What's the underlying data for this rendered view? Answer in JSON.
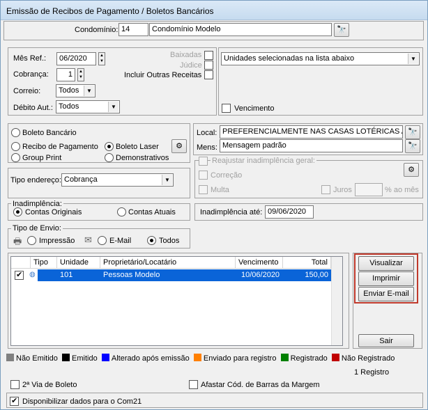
{
  "window": {
    "title": "Emissão de Recibos de Pagamento / Boletos Bancários"
  },
  "condominio": {
    "label": "Condomínio:",
    "code": "14",
    "name": "Condomínio Modelo"
  },
  "params": {
    "mes_ref_label": "Mês Ref.:",
    "mes_ref": "06/2020",
    "cobranca_label": "Cobrança:",
    "cobranca": "1",
    "correio_label": "Correio:",
    "correio": "Todos",
    "debito_label": "Débito Aut.:",
    "debito": "Todos",
    "baixadas": "Baixadas",
    "judice": "Júdice",
    "incluir": "Incluir Outras Receitas"
  },
  "unidades": {
    "selection": "Unidades selecionadas na lista abaixo",
    "vencimento": "Vencimento"
  },
  "tipo": {
    "boleto_bancario": "Boleto Bancário",
    "recibo": "Recibo de Pagamento",
    "group_print": "Group Print",
    "boleto_laser": "Boleto Laser",
    "demonstrativos": "Demonstrativos"
  },
  "local": {
    "label": "Local:",
    "value": "PREFERENCIALMENTE NAS CASAS LOTÉRICAS ATÉ O",
    "mens_label": "Mens:",
    "mens_value": "Mensagem padrão"
  },
  "reajustar": {
    "title": "Reajustar inadimplência geral:",
    "correcao": "Correção",
    "multa": "Multa",
    "juros": "Juros",
    "juros_unit": "% ao mês"
  },
  "endereco": {
    "label": "Tipo endereço:",
    "value": "Cobrança"
  },
  "inadimplencia": {
    "title": "Inadimplência:",
    "originais": "Contas Originais",
    "atuais": "Contas Atuais",
    "ate_label": "Inadimplência até:",
    "ate_value": "09/06/2020"
  },
  "envio": {
    "title": "Tipo de Envio:",
    "impressao": "Impressão",
    "email": "E-Mail",
    "todos": "Todos"
  },
  "table": {
    "headers": [
      "Tipo",
      "Unidade",
      "Proprietário/Locatário",
      "Vencimento",
      "Total"
    ],
    "rows": [
      {
        "unidade": "101",
        "nome": "Pessoas Modelo",
        "vencimento": "10/06/2020",
        "total": "150,00"
      }
    ]
  },
  "buttons": {
    "visualizar": "Visualizar",
    "imprimir": "Imprimir",
    "enviar": "Enviar E-mail",
    "sair": "Sair"
  },
  "legend": [
    {
      "label": "Não Emitido",
      "color": "#808080"
    },
    {
      "label": "Emitido",
      "color": "#000000"
    },
    {
      "label": "Alterado após emissão",
      "color": "#0000ff"
    },
    {
      "label": "Enviado para registro",
      "color": "#ff8000"
    },
    {
      "label": "Registrado",
      "color": "#008000"
    },
    {
      "label": "Não Registrado",
      "color": "#c00000"
    }
  ],
  "footer": {
    "registros": "1 Registro",
    "segunda_via": "2ª Via de Boleto",
    "afastar": "Afastar Cód. de Barras da Margem",
    "disponibilizar": "Disponibilizar dados para o Com21"
  }
}
